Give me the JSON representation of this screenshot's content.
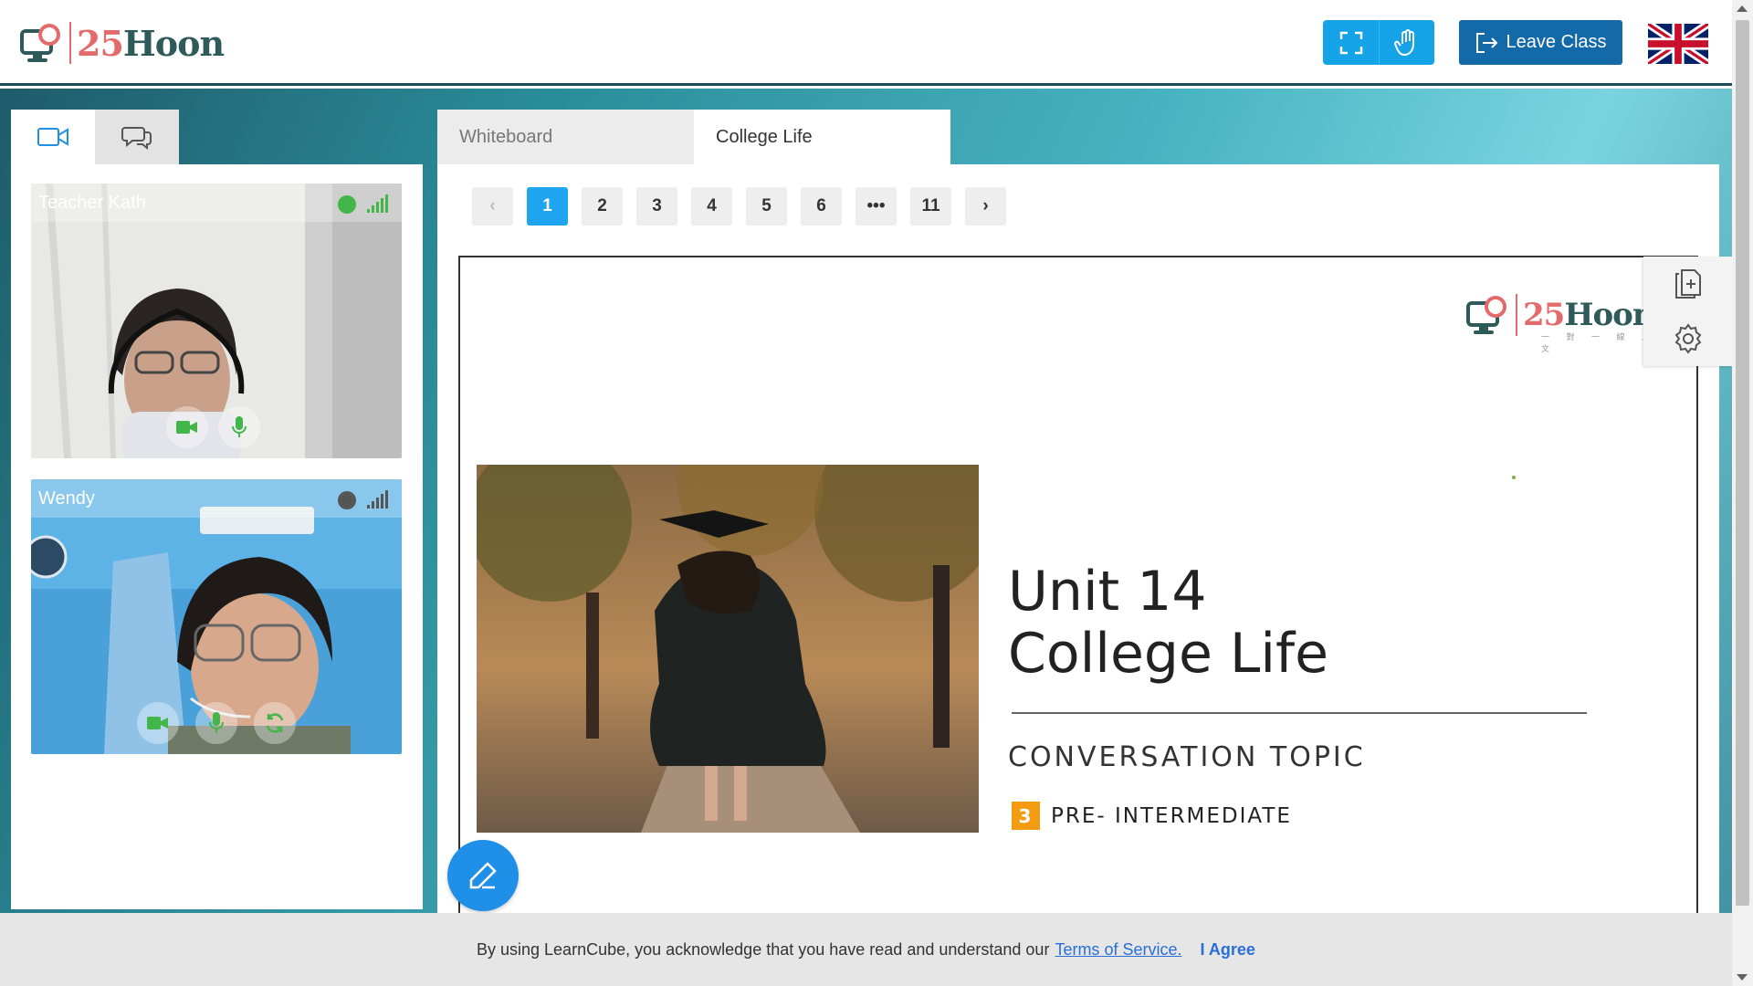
{
  "header": {
    "logo_number": "25",
    "logo_word": "Hoon",
    "leave_label": "Leave Class"
  },
  "left_tabs": [
    {
      "icon": "video-camera-icon"
    },
    {
      "icon": "chat-icon"
    }
  ],
  "videos": [
    {
      "name": "Teacher Kath",
      "status_color": "#43b649",
      "signal_color": "#43b649"
    },
    {
      "name": "Wendy",
      "status_color": "#555555",
      "signal_color": "#555555"
    }
  ],
  "content_tabs": [
    {
      "label": "Whiteboard",
      "active": false
    },
    {
      "label": "College Life",
      "active": true
    }
  ],
  "pager": {
    "prev": "‹",
    "pages": [
      "1",
      "2",
      "3",
      "4",
      "5",
      "6",
      "•••",
      "11"
    ],
    "current": "1",
    "next": "›"
  },
  "slide": {
    "logo_number": "25",
    "logo_word": "Hoon",
    "tagline": "一 對 一 線 上 美 文",
    "title_line1": "Unit 14",
    "title_line2": "College Life",
    "subtitle": "CONVERSATION  TOPIC",
    "level_number": "3",
    "level_label": "PRE- INTERMEDIATE"
  },
  "cookie": {
    "text": "By using LearnCube, you acknowledge that you have read and understand our",
    "link": "Terms of Service.",
    "agree": "I Agree"
  },
  "colors": {
    "primary_blue": "#14a3e6",
    "leave_blue": "#1469a8",
    "brand_red": "#e36b6b",
    "brand_teal": "#2f5a5a"
  }
}
